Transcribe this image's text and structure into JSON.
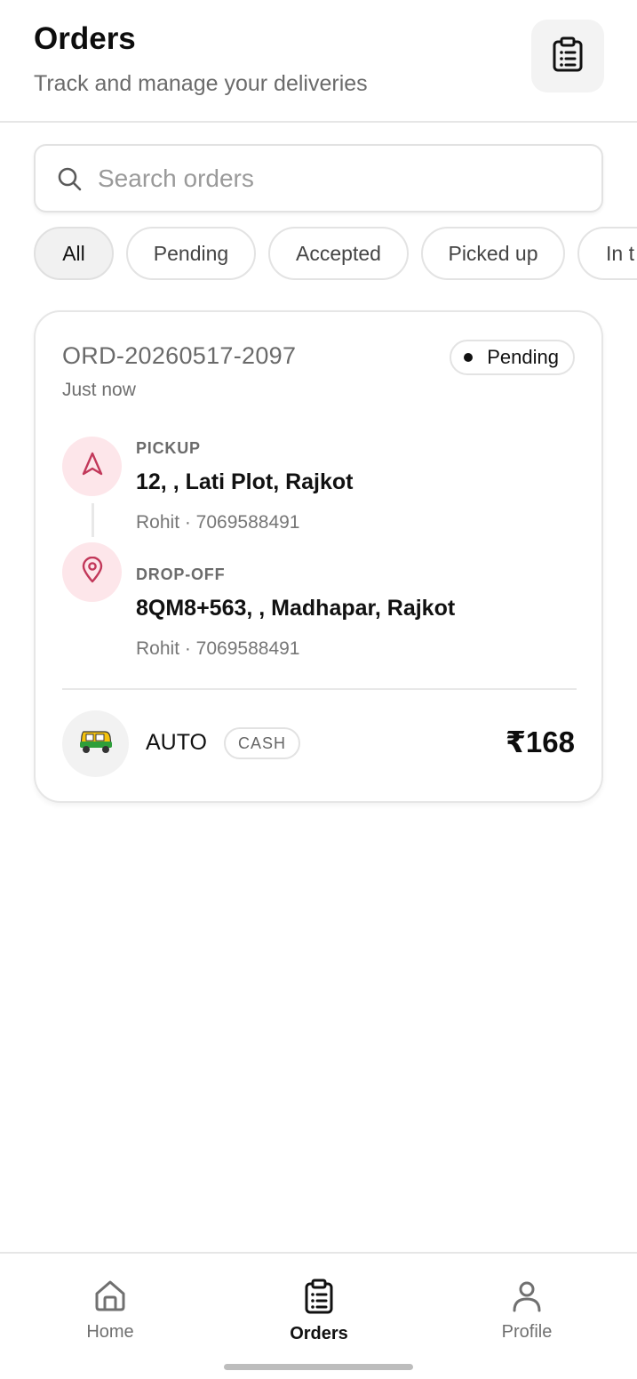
{
  "header": {
    "title": "Orders",
    "subtitle": "Track and manage your deliveries",
    "action_icon": "clipboard-list-icon"
  },
  "search": {
    "placeholder": "Search orders",
    "value": ""
  },
  "filters": [
    {
      "label": "All",
      "active": true
    },
    {
      "label": "Pending",
      "active": false
    },
    {
      "label": "Accepted",
      "active": false
    },
    {
      "label": "Picked up",
      "active": false
    },
    {
      "label": "In t",
      "active": false
    }
  ],
  "orders": [
    {
      "id": "ORD-20260517-2097",
      "time": "Just now",
      "status": "Pending",
      "pickup": {
        "label": "PICKUP",
        "address": "12, , Lati Plot, Rajkot",
        "contact": "Rohit · 7069588491"
      },
      "dropoff": {
        "label": "DROP-OFF",
        "address": "8QM8+563, , Madhapar, Rajkot",
        "contact": "Rohit · 7069588491"
      },
      "vehicle": "AUTO",
      "payment": "CASH",
      "price": "₹168"
    }
  ],
  "nav": [
    {
      "label": "Home",
      "icon": "home-icon",
      "active": false
    },
    {
      "label": "Orders",
      "icon": "clipboard-list-icon",
      "active": true
    },
    {
      "label": "Profile",
      "icon": "user-icon",
      "active": false
    }
  ],
  "colors": {
    "accent_location": "#c2385a",
    "location_bg": "#fde6ea"
  }
}
